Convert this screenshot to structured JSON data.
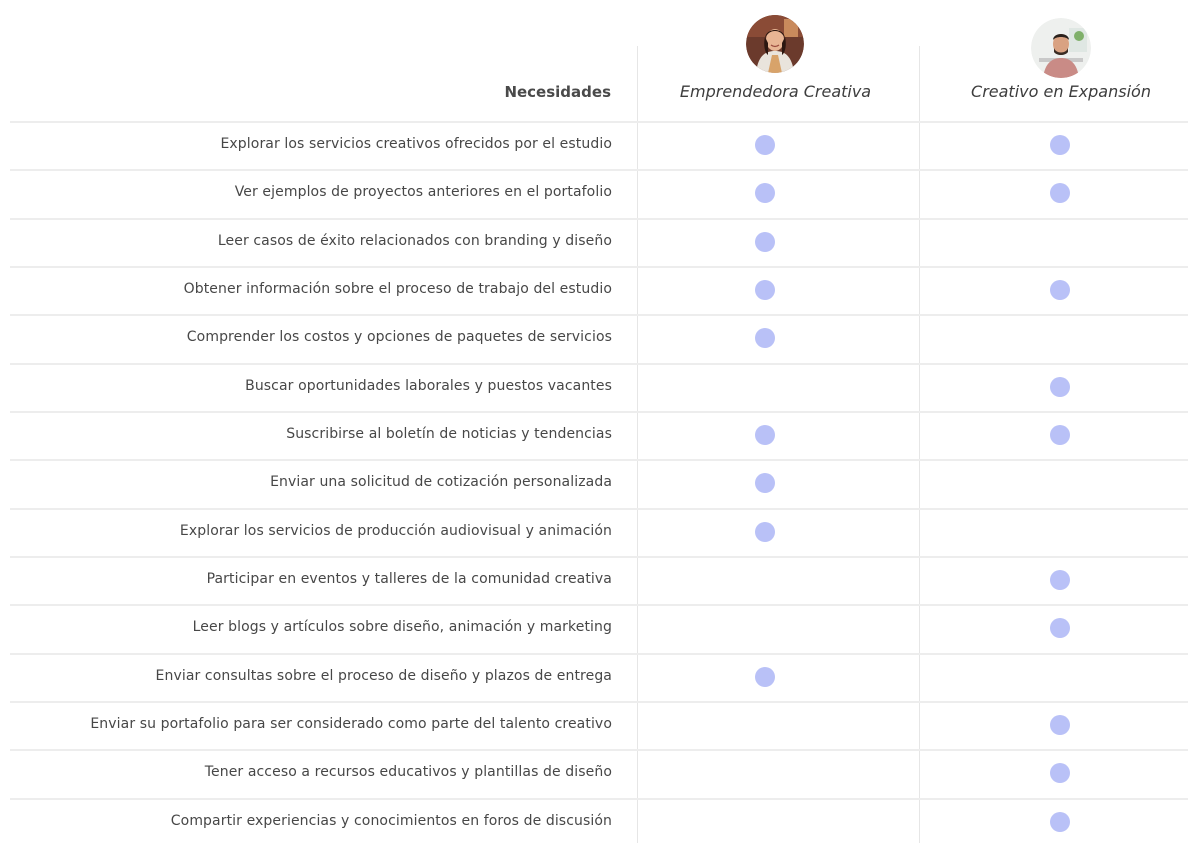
{
  "header": {
    "needs_title": "Necesidades",
    "personas": [
      {
        "name": "Emprendedora Creativa",
        "avatar_icon": "woman-portrait-avatar"
      },
      {
        "name": "Creativo en Expansión",
        "avatar_icon": "man-portrait-avatar"
      }
    ]
  },
  "colors": {
    "mark": "#b9c1f7",
    "divider": "#ededed",
    "text": "#474747"
  },
  "needs": [
    {
      "label": "Explorar los servicios creativos ofrecidos por el estudio",
      "p1": true,
      "p2": true
    },
    {
      "label": "Ver ejemplos de proyectos anteriores en el portafolio",
      "p1": true,
      "p2": true
    },
    {
      "label": "Leer casos de éxito relacionados con branding y diseño",
      "p1": true,
      "p2": false
    },
    {
      "label": "Obtener información sobre el proceso de trabajo del estudio",
      "p1": true,
      "p2": true
    },
    {
      "label": "Comprender los costos y opciones de paquetes de servicios",
      "p1": true,
      "p2": false
    },
    {
      "label": "Buscar oportunidades laborales y puestos vacantes",
      "p1": false,
      "p2": true
    },
    {
      "label": "Suscribirse al boletín de noticias y tendencias",
      "p1": true,
      "p2": true
    },
    {
      "label": "Enviar una solicitud de cotización personalizada",
      "p1": true,
      "p2": false
    },
    {
      "label": "Explorar los servicios de producción audiovisual y animación",
      "p1": true,
      "p2": false
    },
    {
      "label": "Participar en eventos y talleres de la comunidad creativa",
      "p1": false,
      "p2": true
    },
    {
      "label": "Leer blogs y artículos sobre diseño, animación y marketing",
      "p1": false,
      "p2": true
    },
    {
      "label": "Enviar consultas sobre el proceso de diseño y plazos de entrega",
      "p1": true,
      "p2": false
    },
    {
      "label": "Enviar su portafolio para ser considerado como parte del talento creativo",
      "p1": false,
      "p2": true
    },
    {
      "label": "Tener acceso a recursos educativos y plantillas de diseño",
      "p1": false,
      "p2": true
    },
    {
      "label": "Compartir experiencias y conocimientos en foros de discusión",
      "p1": false,
      "p2": true
    }
  ]
}
